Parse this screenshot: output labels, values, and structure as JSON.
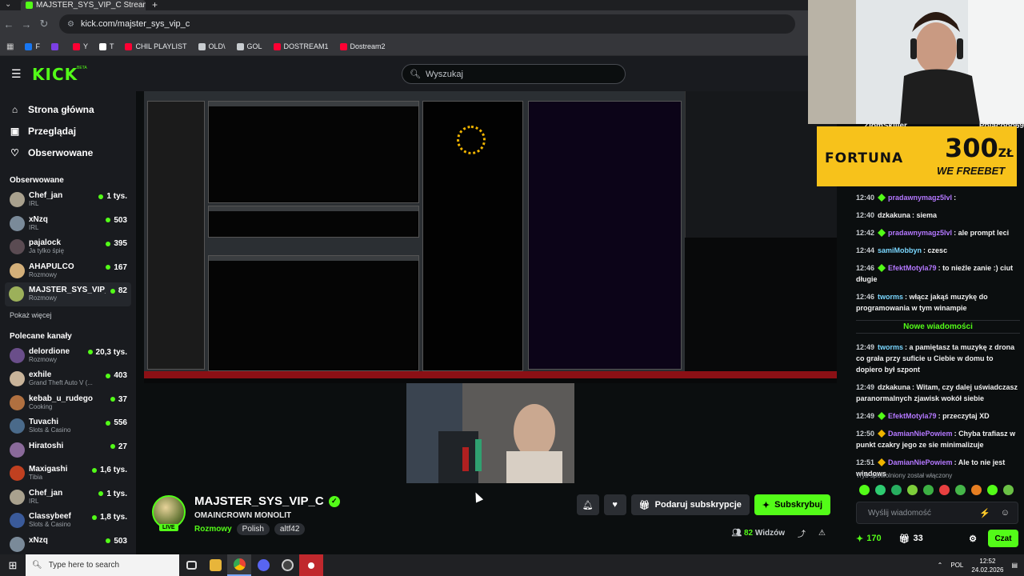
{
  "browser": {
    "tab_title": "MAJSTER_SYS_VIP_C Stream",
    "url": "kick.com/majster_sys_vip_c",
    "bookmarks": [
      {
        "label": "F",
        "color": "#1877f2"
      },
      {
        "label": "",
        "color": "#7b3fe4"
      },
      {
        "label": "Y",
        "color": "#ff0033"
      },
      {
        "label": "T",
        "color": "#ffffff"
      },
      {
        "label": "CHIL PLAYLIST",
        "color": "#ff0033"
      },
      {
        "label": "OLD\\",
        "color": "#c8ccd0"
      },
      {
        "label": "GOL",
        "color": "#c8ccd0"
      },
      {
        "label": "DOSTREAM1",
        "color": "#ff0033"
      },
      {
        "label": "Dostream2",
        "color": "#ff0033"
      }
    ]
  },
  "site": {
    "logo": "KICK",
    "logo_sup": "BETA",
    "search_placeholder": "Wyszukaj"
  },
  "sidebar": {
    "nav": [
      {
        "label": "Strona główna",
        "icon": "home-icon"
      },
      {
        "label": "Przeglądaj",
        "icon": "browse-icon"
      },
      {
        "label": "Obserwowane",
        "icon": "heart-icon"
      }
    ],
    "following_title": "Obserwowane",
    "following": [
      {
        "name": "Chef_jan",
        "cat": "IRL",
        "viewers": "1 tys.",
        "color": "#a9a18e"
      },
      {
        "name": "xNzq",
        "cat": "IRL",
        "viewers": "503",
        "color": "#7a8a99"
      },
      {
        "name": "pajalock",
        "cat": "Ja tylko śpię",
        "viewers": "395",
        "color": "#5a4b52"
      },
      {
        "name": "AHAPULCO",
        "cat": "Rozmowy",
        "viewers": "167",
        "color": "#d4b07a"
      },
      {
        "name": "MAJSTER_SYS_VIP_C",
        "cat": "Rozmowy",
        "viewers": "82",
        "color": "#9cb05a"
      }
    ],
    "show_more": "Pokaż więcej",
    "recommended_title": "Polecane kanały",
    "recommended": [
      {
        "name": "delordione",
        "cat": "Rozmowy",
        "viewers": "20,3 tys.",
        "color": "#6a4e8a"
      },
      {
        "name": "exhile",
        "cat": "Grand Theft Auto V (...",
        "viewers": "403",
        "color": "#c9b49a"
      },
      {
        "name": "kebab_u_rudego",
        "cat": "Cooking",
        "viewers": "37",
        "color": "#b07040"
      },
      {
        "name": "Tuvachi",
        "cat": "Slots & Casino",
        "viewers": "556",
        "color": "#4a6a8a"
      },
      {
        "name": "Hiratoshi",
        "cat": "",
        "viewers": "27",
        "color": "#8a6a9a"
      },
      {
        "name": "Maxigashi",
        "cat": "Tibia",
        "viewers": "1,6 tys.",
        "color": "#c04020"
      },
      {
        "name": "Chef_jan",
        "cat": "IRL",
        "viewers": "1 tys.",
        "color": "#a9a18e"
      },
      {
        "name": "Classybeef",
        "cat": "Slots & Casino",
        "viewers": "1,8 tys.",
        "color": "#3a5a9a"
      },
      {
        "name": "xNzq",
        "cat": "",
        "viewers": "503",
        "color": "#7a8a99"
      }
    ]
  },
  "stream": {
    "name": "MAJSTER_SYS_VIP_C",
    "title": "OMAINCROWN MONOLIT",
    "category": "Rozmowy",
    "tags": [
      "Polish",
      "altf42"
    ],
    "live": "LIVE",
    "gift_label": "Podaruj subskrypcje",
    "subscribe_label": "Subskrybuj",
    "viewers": "82",
    "viewers_label": "Widzów"
  },
  "chat": {
    "top_users": [
      "ZiomSkiller",
      "Polacooo69"
    ],
    "promo": {
      "brand": "FORTUNA",
      "amount": "300",
      "currency": "ZŁ",
      "freebet": "WE FREEBET"
    },
    "messages": [
      {
        "time": "12:40",
        "user": "pradawnymagz5lvl",
        "color": "#b478ff",
        "badge": "#53fc18",
        "text": ""
      },
      {
        "time": "12:40",
        "user": "dzkakuna",
        "color": "#f0f0f0",
        "badge": "",
        "text": "siema"
      },
      {
        "time": "12:42",
        "user": "pradawnymagz5lvl",
        "color": "#b478ff",
        "badge": "#53fc18",
        "text": "ale prompt leci"
      },
      {
        "time": "12:44",
        "user": "samiMobbyn",
        "color": "#7ad7ff",
        "badge": "",
        "text": "czesc"
      },
      {
        "time": "12:46",
        "user": "EfektMotyla79",
        "color": "#b478ff",
        "badge": "#53fc18",
        "text": "to nieźle zanie :) ciut długie"
      },
      {
        "time": "12:46",
        "user": "tworms",
        "color": "#7ad7ff",
        "badge": "",
        "text": "włącz jakąś muzykę do programowania w tym winampie"
      }
    ],
    "new_messages": "Nowe wiadomości",
    "messages2": [
      {
        "time": "12:49",
        "user": "tworms",
        "color": "#7ad7ff",
        "badge": "",
        "text": "a pamiętasz ta muzykę z drona co grała przy suficie u Ciebie w domu to dopiero był szpont"
      },
      {
        "time": "12:49",
        "user": "dzkakuna",
        "color": "#f0f0f0",
        "badge": "",
        "text": "Witam, czy dalej uświadczasz paranormalnych zjawisk wokół siebie"
      },
      {
        "time": "12:49",
        "user": "EfektMotyla79",
        "color": "#b478ff",
        "badge": "#53fc18",
        "text": "przeczytaj XD"
      },
      {
        "time": "12:50",
        "user": "DamianNiePowiem",
        "color": "#b478ff",
        "badge": "#f0b400",
        "text": "Chyba trafiasz w punkt czakry jego ze sie minimalizuje"
      },
      {
        "time": "12:51",
        "user": "DamianNiePowiem",
        "color": "#b478ff",
        "badge": "#f0b400",
        "text": "Ale to nie jest windows"
      }
    ],
    "slow_mode": "Tryb spowolniony został włączony",
    "input_placeholder": "Wyślij wiadomość",
    "points": "170",
    "gifts": "33",
    "send_label": "Czat"
  },
  "taskbar": {
    "search_placeholder": "Type here to search",
    "lang": "POL",
    "time": "12:52",
    "date": "24.02.2026"
  }
}
